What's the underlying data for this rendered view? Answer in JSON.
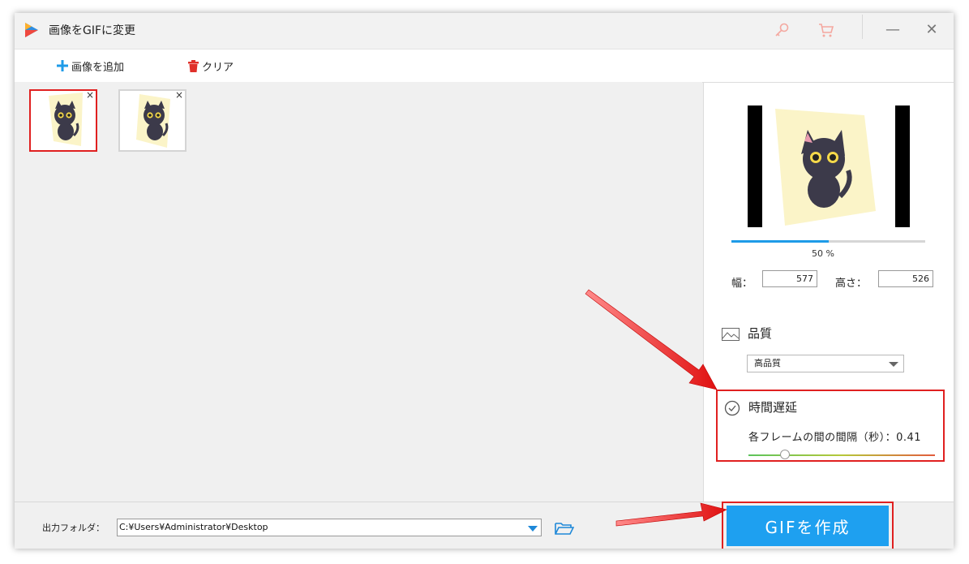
{
  "window": {
    "title": "画像をGIFに変更",
    "controls": {
      "minimize": "—",
      "close": "✕"
    },
    "icons": [
      "key-icon",
      "cart-icon"
    ]
  },
  "toolbar": {
    "add_images_label": "画像を追加",
    "clear_label": "クリア"
  },
  "thumbnails": [
    {
      "close": "×",
      "selected": true
    },
    {
      "close": "×",
      "selected": false
    }
  ],
  "preview": {
    "progress_percent": 50,
    "progress_label": "50 %",
    "width_label": "幅：",
    "width_value": "577",
    "height_label": "高さ：",
    "height_value": "526"
  },
  "quality": {
    "label": "品質",
    "selected": "高品質"
  },
  "delay": {
    "title": "時間遅延",
    "text": "各フレームの間の間隔（秒）：0.41",
    "value": 0.41
  },
  "output": {
    "label": "出力フォルダ：",
    "path": "C:¥Users¥Administrator¥Desktop"
  },
  "create_button": {
    "label": "GIFを作成"
  },
  "colors": {
    "accent": "#1ea0f0",
    "highlight": "#e02020"
  }
}
